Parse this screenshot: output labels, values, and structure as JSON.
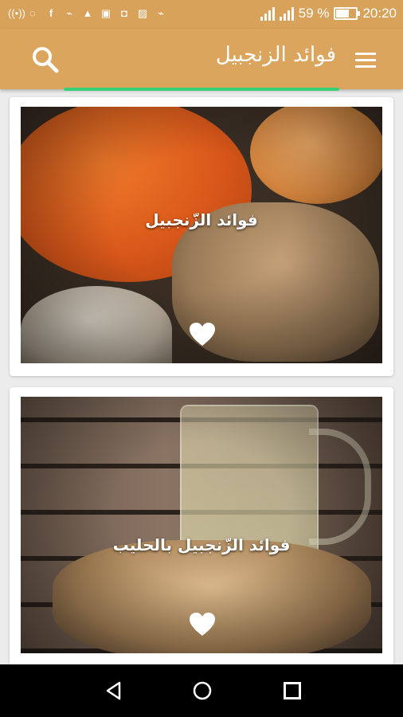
{
  "status_bar": {
    "battery_text": "59 %",
    "time": "20:20",
    "battery_level": 0.59,
    "icons": [
      "radio-icon",
      "chat-bubble-icon",
      "facebook-icon",
      "messenger-icon",
      "notification-icon",
      "bbm-icon",
      "instagram-icon",
      "gallery-icon",
      "messenger-icon"
    ]
  },
  "app_bar": {
    "title": "فوائد الزنجبيل"
  },
  "cards": [
    {
      "caption": "فوائد الزّنجبيل"
    },
    {
      "caption": "فوائد الزّنجبيل بالحليب"
    }
  ],
  "colors": {
    "app_bar": "#dba55d",
    "accent": "#3ad07a"
  }
}
